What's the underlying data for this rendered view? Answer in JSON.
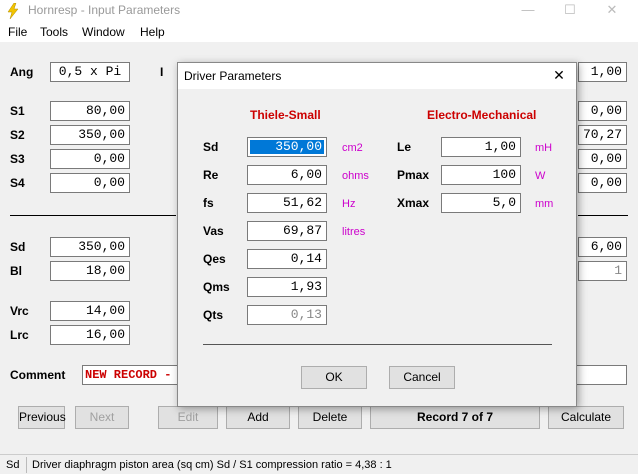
{
  "window": {
    "title": "Hornresp - Input Parameters",
    "minimize": "—",
    "maximize": "☐",
    "close": "✕"
  },
  "menu": [
    "File",
    "Tools",
    "Window",
    "Help"
  ],
  "main": {
    "ang_label": "Ang",
    "ang_value": "0,5 x Pi",
    "s_rows": [
      {
        "label": "S1",
        "value": "80,00"
      },
      {
        "label": "S2",
        "value": "350,00"
      },
      {
        "label": "S3",
        "value": "0,00"
      },
      {
        "label": "S4",
        "value": "0,00"
      }
    ],
    "right_fields": [
      "1,00",
      "0,00",
      "70,27",
      "0,00",
      "0,00",
      "6,00",
      "1"
    ],
    "driver_rows": [
      {
        "label": "Sd",
        "value": "350,00"
      },
      {
        "label": "Bl",
        "value": "18,00"
      },
      {
        "label": "Vrc",
        "value": "14,00"
      },
      {
        "label": "Lrc",
        "value": "16,00"
      }
    ],
    "comment_label": "Comment",
    "comment_value": "NEW RECORD -"
  },
  "buttons": {
    "previous": "Previous",
    "next": "Next",
    "edit": "Edit",
    "add": "Add",
    "delete": "Delete",
    "record": "Record 7 of 7",
    "calculate": "Calculate"
  },
  "status": {
    "cell1": "Sd",
    "cell2": "Driver diaphragm piston area  (sq cm)   Sd / S1 compression ratio = 4,38 : 1"
  },
  "dialog": {
    "title": "Driver Parameters",
    "close": "✕",
    "thiele_small_title": "Thiele-Small",
    "electro_mechanical_title": "Electro-Mechanical",
    "ts_params": [
      {
        "label": "Sd",
        "value": "350,00",
        "unit": "cm2"
      },
      {
        "label": "Re",
        "value": "6,00",
        "unit": "ohms"
      },
      {
        "label": "fs",
        "value": "51,62",
        "unit": "Hz"
      },
      {
        "label": "Vas",
        "value": "69,87",
        "unit": "litres"
      },
      {
        "label": "Qes",
        "value": "0,14",
        "unit": ""
      },
      {
        "label": "Qms",
        "value": "1,93",
        "unit": ""
      },
      {
        "label": "Qts",
        "value": "0,13",
        "unit": ""
      }
    ],
    "em_params": [
      {
        "label": "Le",
        "value": "1,00",
        "unit": "mH"
      },
      {
        "label": "Pmax",
        "value": "100",
        "unit": "W"
      },
      {
        "label": "Xmax",
        "value": "5,0",
        "unit": "mm"
      }
    ],
    "ok": "OK",
    "cancel": "Cancel"
  },
  "colors": {
    "accent_red": "#cc0000",
    "unit_magenta": "#cc00cc",
    "selection_blue": "#0078d7"
  }
}
